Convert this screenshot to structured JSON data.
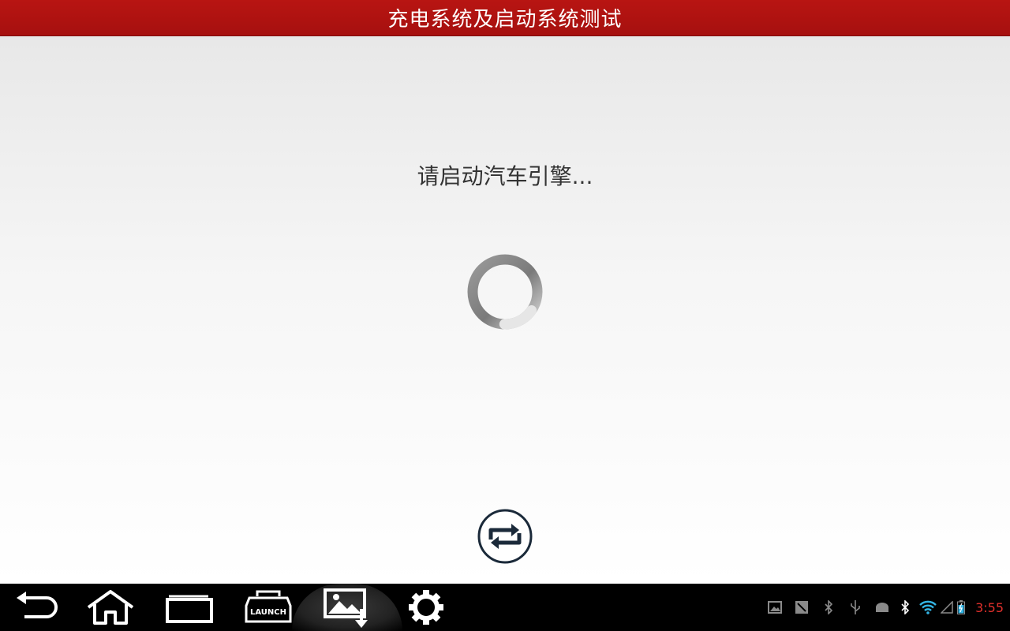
{
  "titlebar": {
    "title": "充电系统及启动系统测试"
  },
  "main": {
    "message": "请启动汽车引擎...",
    "spinner_icon": "loading-spinner",
    "refresh_icon": "repeat-icon"
  },
  "navbar": {
    "buttons": [
      {
        "name": "back",
        "icon": "back-arrow-icon"
      },
      {
        "name": "home",
        "icon": "home-icon"
      },
      {
        "name": "recent-apps",
        "icon": "recent-apps-icon"
      },
      {
        "name": "launch",
        "icon": "launch-icon",
        "label": "LAUNCH"
      },
      {
        "name": "screenshot",
        "icon": "screenshot-icon"
      },
      {
        "name": "settings",
        "icon": "gear-icon"
      }
    ],
    "status_icons": [
      "image-notification-icon",
      "notification-icon",
      "bluetooth-notification-icon",
      "usb-icon",
      "android-debug-icon",
      "bluetooth-icon",
      "wifi-icon",
      "signal-icon",
      "battery-icon"
    ],
    "clock": "3:55"
  },
  "colors": {
    "titlebar": "#b81512",
    "clock": "#e0302c",
    "wifi": "#33b5e5"
  }
}
